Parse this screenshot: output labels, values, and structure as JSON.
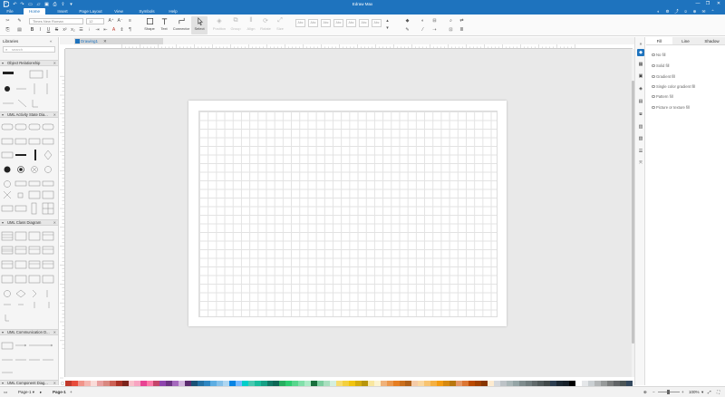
{
  "window": {
    "title": "Edraw Max",
    "controls": [
      "—",
      "❐",
      "✕"
    ]
  },
  "menu": {
    "tabs": [
      "File",
      "Home",
      "Insert",
      "Page Layout",
      "View",
      "Symbols",
      "Help"
    ],
    "active": "Home"
  },
  "ribbon": {
    "font_family": "Times New Roman",
    "font_size": "12",
    "tools": {
      "shape": "Shape",
      "text": "Text",
      "connector": "Connector",
      "select": "Select"
    },
    "disabled_tools": [
      "Position",
      "Group",
      "Align",
      "Rotate",
      "Size"
    ],
    "style_samples": [
      "Abc",
      "Abc",
      "Abc",
      "Abc",
      "Abc",
      "Abc",
      "Abc"
    ]
  },
  "libraries": {
    "title": "Libraries",
    "search_placeholder": "search",
    "sections": [
      "Object Relationship",
      "UML Activity State Dia...",
      "UML Class Diagram",
      "UML Communication D...",
      "UML Component Diag..."
    ]
  },
  "document": {
    "tab_name": "Drawing1"
  },
  "fill_panel": {
    "tabs": [
      "Fill",
      "Line",
      "Shadow"
    ],
    "active_tab": "Fill",
    "options": [
      "No fill",
      "Solid fill",
      "Gradient fill",
      "Single color gradient fill",
      "Pattern fill",
      "Picture or texture fill"
    ]
  },
  "status": {
    "page_selector": "Page-1",
    "page_tab": "Page-1",
    "zoom": "100%"
  },
  "colors": {
    "accent": "#1e73be",
    "palette": [
      "#c0392b",
      "#e74c3c",
      "#f1948a",
      "#f5b7b1",
      "#fadbd8",
      "#e8a0a0",
      "#d98880",
      "#cd6155",
      "#a93226",
      "#7b241c",
      "#f9c0cb",
      "#f8a5c2",
      "#e84393",
      "#fd79a8",
      "#c44569",
      "#8e44ad",
      "#6c3483",
      "#a569bd",
      "#d2b4de",
      "#5b2c6f",
      "#1a5276",
      "#2471a3",
      "#2e86c1",
      "#5dade2",
      "#85c1e9",
      "#aed6f1",
      "#0984e3",
      "#74b9ff",
      "#00cec9",
      "#48c9b0",
      "#1abc9c",
      "#16a085",
      "#117864",
      "#0e6655",
      "#27ae60",
      "#2ecc71",
      "#58d68d",
      "#82e0aa",
      "#abebc6",
      "#196f3d",
      "#7dcea0",
      "#a9dfbf",
      "#d4efdf",
      "#f7dc6f",
      "#f4d03f",
      "#f1c40f",
      "#d4ac0d",
      "#b7950b",
      "#f9e79f",
      "#fcf3cf",
      "#f0b27a",
      "#eb984e",
      "#e67e22",
      "#ca6f1e",
      "#af601a",
      "#f5cba7",
      "#fad7a0",
      "#f8c471",
      "#f5b041",
      "#f39c12",
      "#d68910",
      "#b9770e",
      "#e59866",
      "#dc7633",
      "#ba4a00",
      "#a04000",
      "#873600",
      "#fdebd0",
      "#d5d8dc",
      "#bdc3c7",
      "#aab7b8",
      "#95a5a6",
      "#7f8c8d",
      "#717d7e",
      "#616a6b",
      "#515a5a",
      "#424949",
      "#2c3e50",
      "#1c2833",
      "#17202a",
      "#000000",
      "#ffffff",
      "#e5e7e9",
      "#cacfd2",
      "#b3b6b7",
      "#979a9a",
      "#7b7d7d",
      "#626567",
      "#4d5656",
      "#34495e"
    ]
  }
}
